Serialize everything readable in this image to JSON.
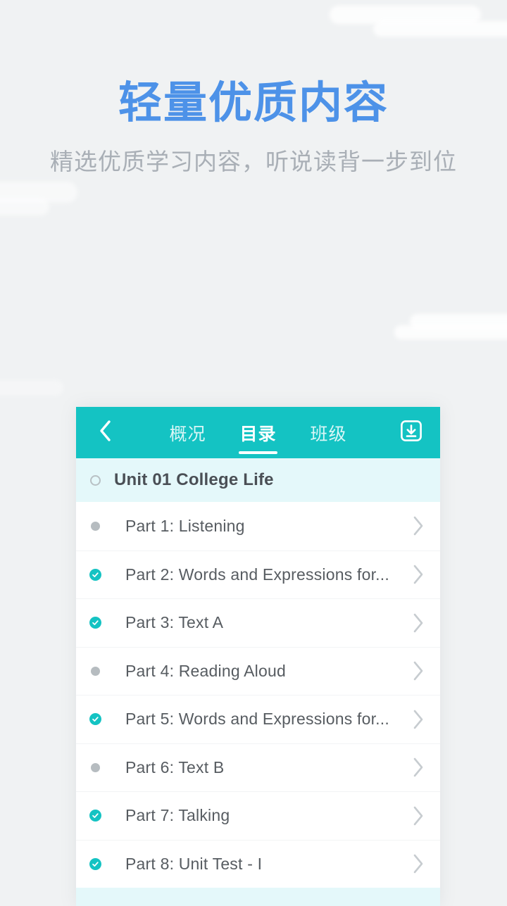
{
  "promo": {
    "title": "轻量优质内容",
    "subtitle": "精选优质学习内容，听说读背一步到位",
    "title_color": "#4d92e8",
    "subtitle_color": "#a9afb6",
    "background_color": "#f0f2f3"
  },
  "app": {
    "accent_color": "#14c3c3",
    "appbar": {
      "back_icon": "chevron-left-icon",
      "download_icon": "download-box-icon",
      "tabs": [
        {
          "label": "概况",
          "active": false
        },
        {
          "label": "目录",
          "active": true
        },
        {
          "label": "班级",
          "active": false
        }
      ]
    },
    "unit": {
      "title": "Unit 01 College Life",
      "marker": "circle-outline-icon",
      "row_color": "#e4f8fa"
    },
    "parts": [
      {
        "title": "Part 1: Listening",
        "status": "pending",
        "marker": "dot-icon",
        "chevron": "chevron-right-icon"
      },
      {
        "title": "Part 2: Words and Expressions for...",
        "status": "completed",
        "marker": "check-circle-icon",
        "chevron": "chevron-right-icon"
      },
      {
        "title": "Part 3: Text A",
        "status": "completed",
        "marker": "check-circle-icon",
        "chevron": "chevron-right-icon"
      },
      {
        "title": "Part 4: Reading Aloud",
        "status": "pending",
        "marker": "dot-icon",
        "chevron": "chevron-right-icon"
      },
      {
        "title": "Part 5: Words and Expressions for...",
        "status": "completed",
        "marker": "check-circle-icon",
        "chevron": "chevron-right-icon"
      },
      {
        "title": "Part 6: Text B",
        "status": "pending",
        "marker": "dot-icon",
        "chevron": "chevron-right-icon"
      },
      {
        "title": "Part 7: Talking",
        "status": "completed",
        "marker": "check-circle-icon",
        "chevron": "chevron-right-icon"
      },
      {
        "title": "Part 8: Unit Test - I",
        "status": "completed",
        "marker": "check-circle-icon",
        "chevron": "chevron-right-icon"
      }
    ]
  }
}
